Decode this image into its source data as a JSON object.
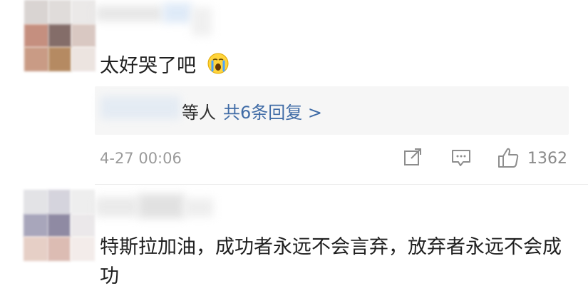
{
  "comment1": {
    "text": "太好哭了吧",
    "emoji_icon": "loudly-crying-face-icon"
  },
  "replies": {
    "suffix": "等人",
    "link": "共6条回复 >"
  },
  "meta": {
    "timestamp": "4-27 00:06",
    "like_count": "1362",
    "share_icon": "share-icon",
    "comment_icon": "comment-icon",
    "like_icon": "thumbs-up-icon"
  },
  "comment2": {
    "text": "特斯拉加油，成功者永远不会言弃，放弃者永远不会成功"
  },
  "colors": {
    "link": "#3f6ba6",
    "meta_gray": "#9a9a9a",
    "reply_bg": "#f6f6f6"
  }
}
